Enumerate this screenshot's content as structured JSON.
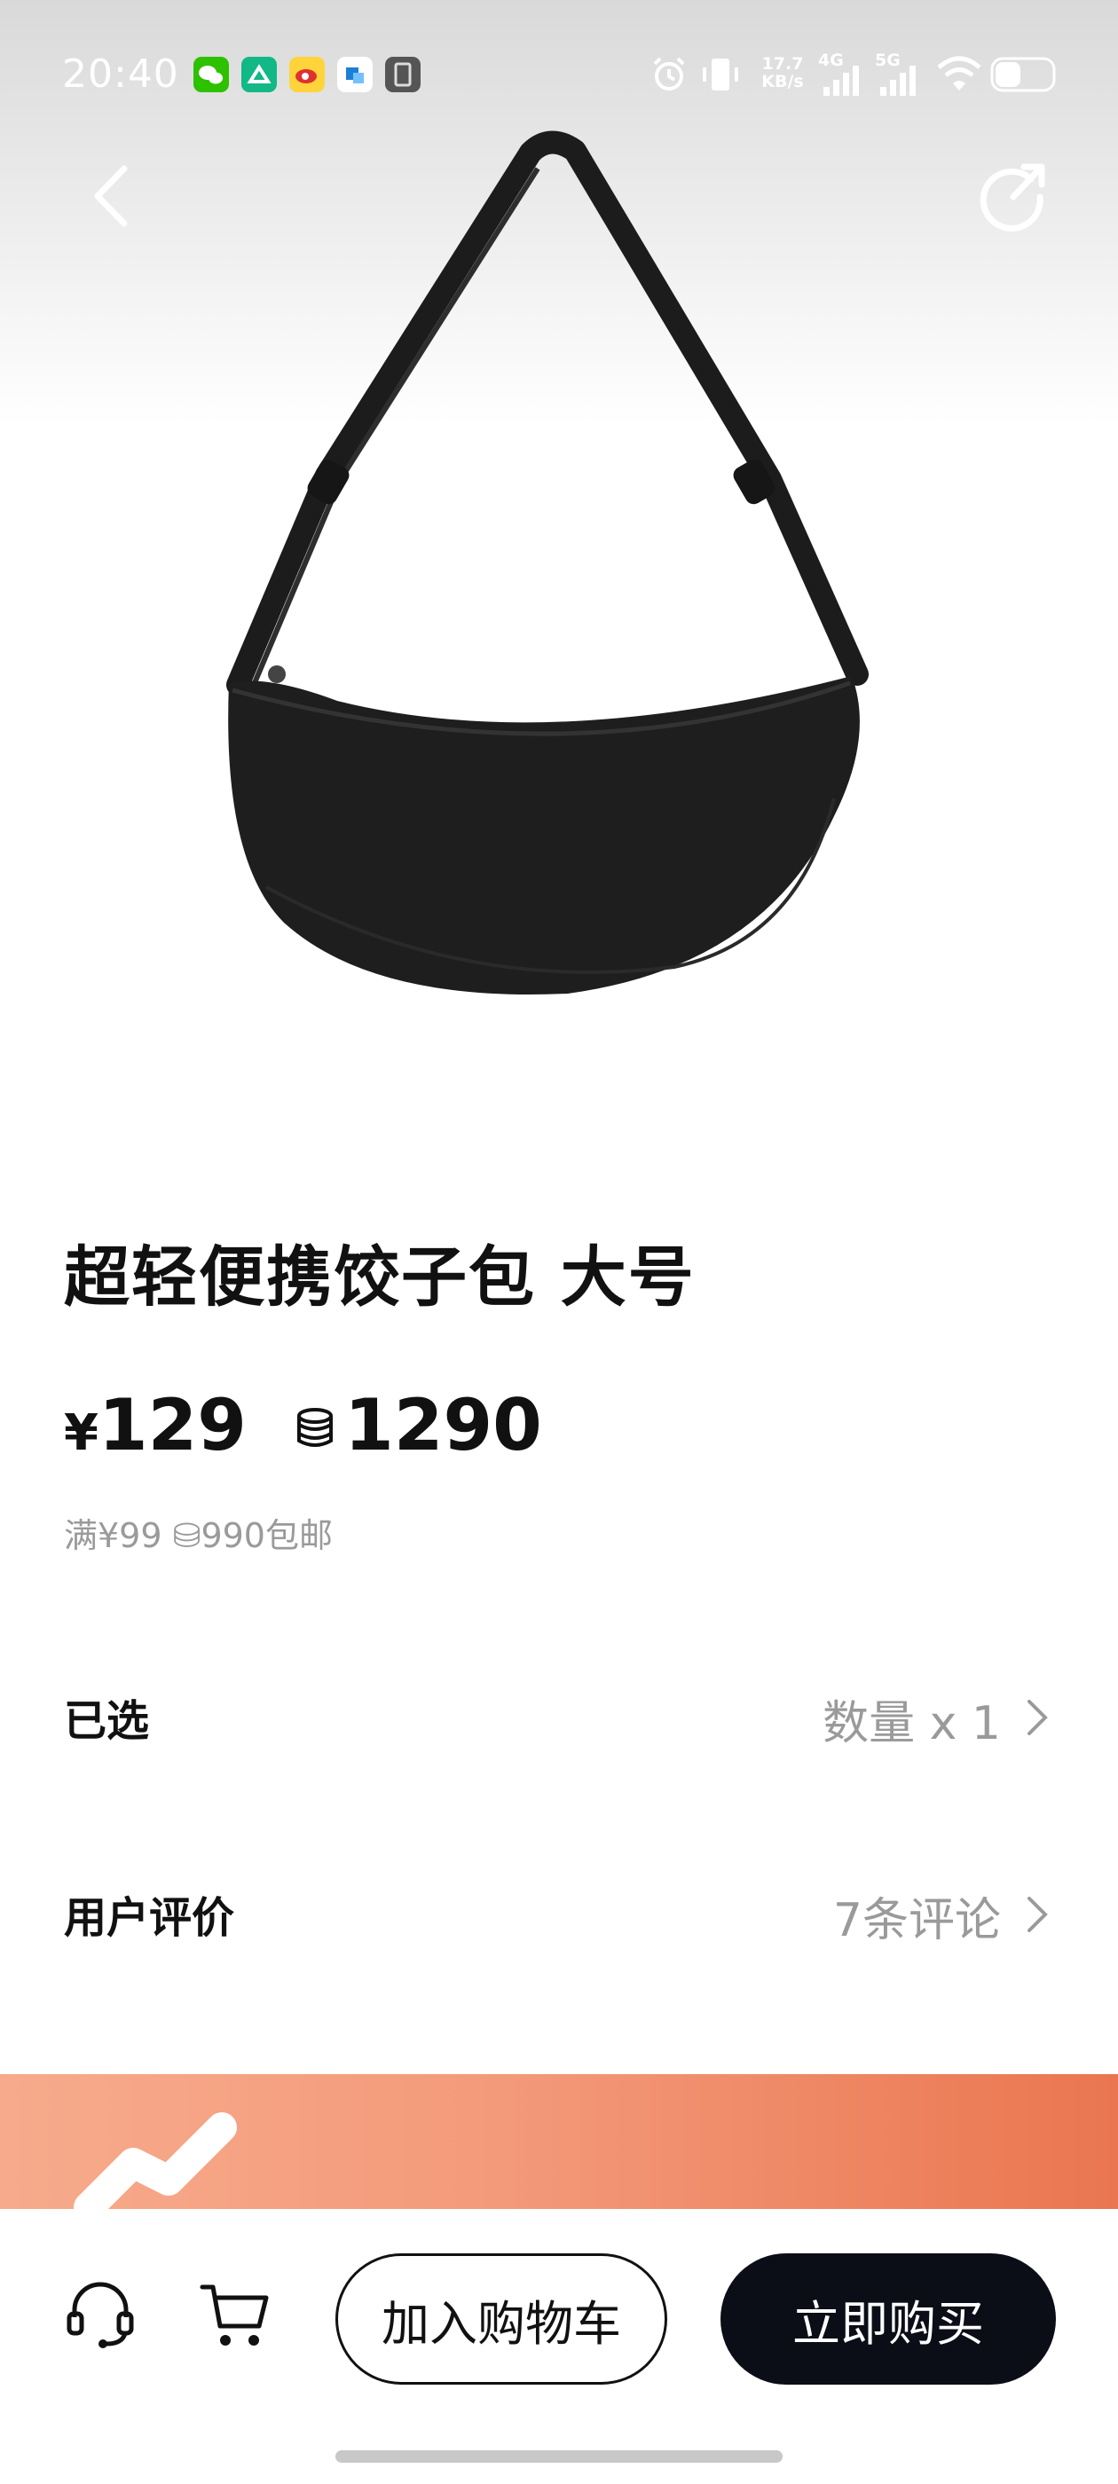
{
  "status_bar": {
    "time": "20:40",
    "network_speed_top": "17.7",
    "network_speed_bottom": "KB/s",
    "signal_1_label": "4G",
    "signal_2_label": "5G",
    "weibo_badge": "微博"
  },
  "nav": {
    "back_icon": "chevron-left-icon",
    "share_icon": "share-icon"
  },
  "product": {
    "title": "超轻便携饺子包 大号",
    "price_currency": "¥",
    "price": "129",
    "coin_price": "1290",
    "shipping_note": "满¥99 ⛁990包邮"
  },
  "rows": {
    "selected_label": "已选",
    "selected_value": "数量 x 1",
    "reviews_label": "用户评价",
    "reviews_value": "7条评论"
  },
  "bottom_bar": {
    "add_to_cart": "加入购物车",
    "buy_now": "立即购买"
  },
  "colors": {
    "primary_button": "#0b0d17",
    "banner_start": "#f7ab8c",
    "banner_end": "#ea7650",
    "muted_text": "#9a9a9a"
  }
}
